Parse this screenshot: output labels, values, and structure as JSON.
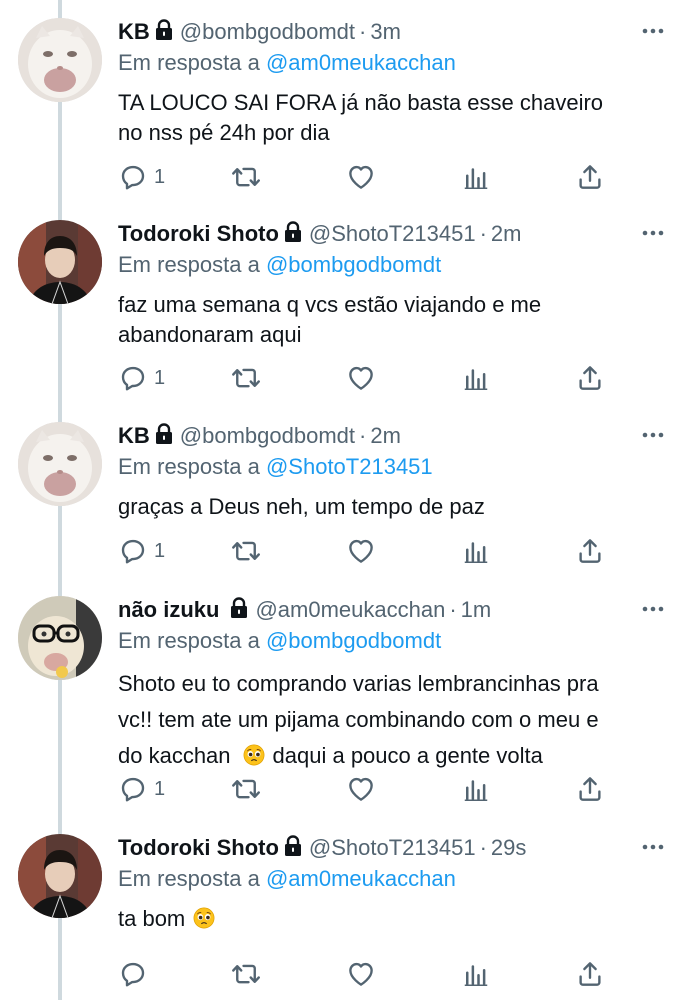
{
  "tweets": [
    {
      "name": "KB",
      "handle": "@bombgodbomdt",
      "time": "3m",
      "reply_prefix": "Em resposta a",
      "reply_to": "@am0meukacchan",
      "text_lines": [
        "TA LOUCO SAI FORA já não basta esse chaveiro",
        "no nss pé 24h por dia"
      ],
      "reply_count": "1",
      "avatar": "white-cat-avatar"
    },
    {
      "name": "Todoroki Shoto",
      "handle": "@ShotoT213451",
      "time": "2m",
      "reply_prefix": "Em resposta a",
      "reply_to": "@bombgodbomdt",
      "text_lines": [
        "faz uma semana q vcs estão viajando e me",
        "abandonaram aqui"
      ],
      "reply_count": "1",
      "avatar": "person-avatar"
    },
    {
      "name": "KB",
      "handle": "@bombgodbomdt",
      "time": "2m",
      "reply_prefix": "Em resposta a",
      "reply_to": "@ShotoT213451",
      "text_lines": [
        "graças a Deus neh, um tempo de paz"
      ],
      "reply_count": "1",
      "avatar": "white-cat-avatar"
    },
    {
      "name": "não izuku",
      "handle": "@am0meukacchan",
      "time": "1m",
      "reply_prefix": "Em resposta a",
      "reply_to": "@bombgodbomdt",
      "text_lines": [
        "Shoto eu to comprando varias lembrancinhas pra",
        "vc!! tem ate um pijama combinando com o meu e",
        "do kacchan",
        "daqui a pouco a gente volta"
      ],
      "reply_count": "1",
      "avatar": "glasses-cat-avatar"
    },
    {
      "name": "Todoroki Shoto",
      "handle": "@ShotoT213451",
      "time": "29s",
      "reply_prefix": "Em resposta a",
      "reply_to": "@am0meukacchan",
      "text_lines": [
        "ta bom"
      ],
      "reply_count": "",
      "avatar": "person-avatar"
    }
  ],
  "icons": {
    "reply": "reply-icon",
    "retweet": "retweet-icon",
    "like": "heart-icon",
    "views": "analytics-icon",
    "share": "share-icon",
    "more": "more-icon",
    "lock": "lock-icon",
    "emoji": "pleading-face-emoji"
  },
  "colors": {
    "link": "#1d9bf0",
    "secondary": "#536471",
    "thread_line": "#cfd9de"
  }
}
